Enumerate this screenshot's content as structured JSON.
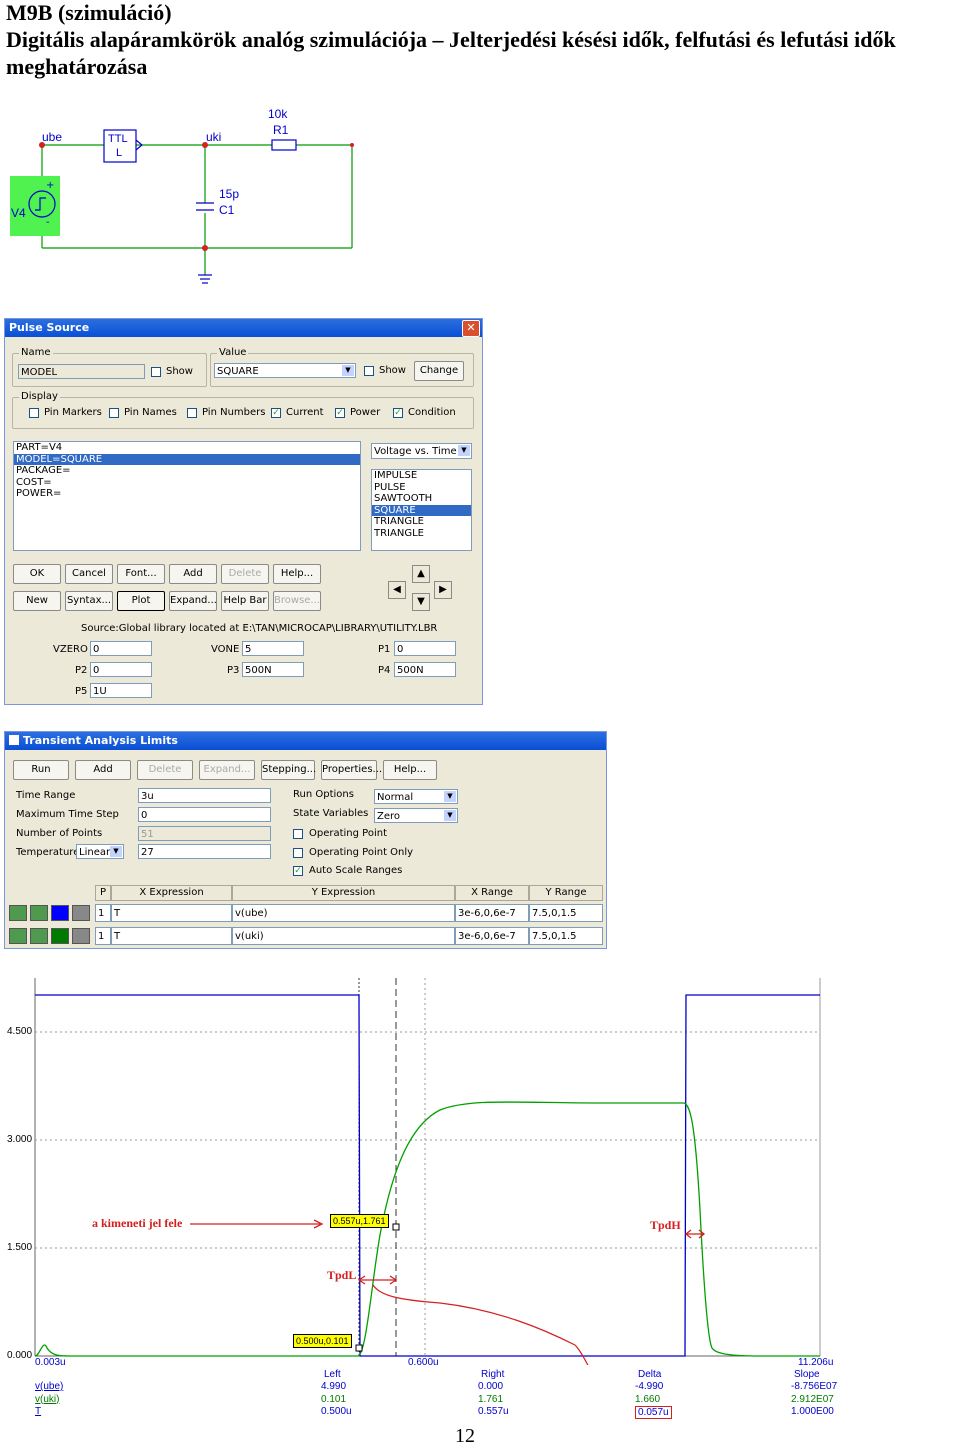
{
  "header": {
    "line1": "M9B (szimuláció)",
    "line2": "Digitális alapáramkörök analóg szimulációja – Jelterjedési késési idők, felfutási és lefutási idők",
    "line3": "meghatározása"
  },
  "schematic": {
    "node_ube": "ube",
    "node_uki": "uki",
    "gate_line1": "TTL",
    "gate_line2": "L",
    "r_value": "10k",
    "r_name": "R1",
    "c_value": "15p",
    "c_name": "C1",
    "source_name": "V4",
    "plus": "+",
    "minus": "-"
  },
  "pulse": {
    "title": "Pulse Source",
    "name_group": "Name",
    "name_value": "MODEL",
    "show1": "Show",
    "value_group": "Value",
    "value_value": "SQUARE",
    "show2": "Show",
    "change": "Change",
    "display_group": "Display",
    "display_checks": [
      "Pin Markers",
      "Pin Names",
      "Pin Numbers",
      "Current",
      "Power",
      "Condition"
    ],
    "attr_list": [
      "PART=V4",
      "MODEL=SQUARE",
      "PACKAGE=",
      "COST=",
      "POWER="
    ],
    "plot_select": "Voltage vs. Time",
    "models": [
      "IMPULSE",
      "PULSE",
      "SAWTOOTH",
      "SQUARE",
      "TRIANGLE",
      "TRIANGLE"
    ],
    "buttons_row1": [
      "OK",
      "Cancel",
      "Font...",
      "Add",
      "Delete",
      "Help..."
    ],
    "buttons_row2": [
      "New",
      "Syntax...",
      "Plot",
      "Expand...",
      "Help Bar",
      "Browse..."
    ],
    "source": "Source:Global library located at E:\\TAN\\MICROCAP\\LIBRARY\\UTILITY.LBR",
    "params": {
      "vzero_l": "VZERO",
      "vzero": "0",
      "vone_l": "VONE",
      "vone": "5",
      "p1_l": "P1",
      "p1": "0",
      "p2_l": "P2",
      "p2": "0",
      "p3_l": "P3",
      "p3": "500N",
      "p4_l": "P4",
      "p4": "500N",
      "p5_l": "P5",
      "p5": "1U"
    }
  },
  "transient": {
    "title": "Transient Analysis Limits",
    "buttons": [
      "Run",
      "Add",
      "Delete",
      "Expand...",
      "Stepping...",
      "Properties...",
      "Help..."
    ],
    "time_range_l": "Time Range",
    "time_range": "3u",
    "max_step_l": "Maximum Time Step",
    "max_step": "0",
    "points_l": "Number of Points",
    "points": "51",
    "temp_l": "Temperature",
    "temp_mode": "Linear",
    "temp": "27",
    "run_options_l": "Run Options",
    "run_options": "Normal",
    "state_vars_l": "State Variables",
    "state_vars": "Zero",
    "op_point": "Operating Point",
    "op_point_only": "Operating Point Only",
    "auto_scale": "Auto Scale Ranges",
    "cols": [
      "P",
      "X Expression",
      "Y Expression",
      "X Range",
      "Y Range"
    ],
    "rows": [
      {
        "p": "1",
        "x": "T",
        "y": "v(ube)",
        "xr": "3e-6,0,6e-7",
        "yr": "7.5,0,1.5",
        "color": "#0000ff"
      },
      {
        "p": "1",
        "x": "T",
        "y": "v(uki)",
        "xr": "3e-6,0,6e-7",
        "yr": "7.5,0,1.5",
        "color": "#007a00"
      }
    ]
  },
  "plot": {
    "yticks": [
      "4.500",
      "3.000",
      "1.500",
      "0.000"
    ],
    "x_left": "0.003u",
    "x_mid": "0.600u",
    "x_right": "11.206u",
    "cursor_hi": "0.557u,1.761",
    "cursor_lo": "0.500u,0.101",
    "anno_half": "a kimeneti jel fele",
    "anno_tpdl": "TpdL",
    "anno_tpdh": "TpdH",
    "table_cols": [
      "Left",
      "Right",
      "Delta",
      "Slope"
    ],
    "table_rows": [
      {
        "name": "v(ube)",
        "left": "4.990",
        "right": "0.000",
        "delta": "-4.990",
        "slope": "-8.756E07",
        "color": "#0000cc"
      },
      {
        "name": "v(uki)",
        "left": "0.101",
        "right": "1.761",
        "delta": "1.660",
        "slope": "2.912E07",
        "color": "#007a00"
      },
      {
        "name": "T",
        "left": "0.500u",
        "right": "0.557u",
        "delta": "0.057u",
        "slope": "1.000E00",
        "color": "#0000cc"
      }
    ],
    "colors": {
      "ube": "#0000cc",
      "uki": "#00a000",
      "annot": "#d42020"
    }
  },
  "page_number": "12"
}
